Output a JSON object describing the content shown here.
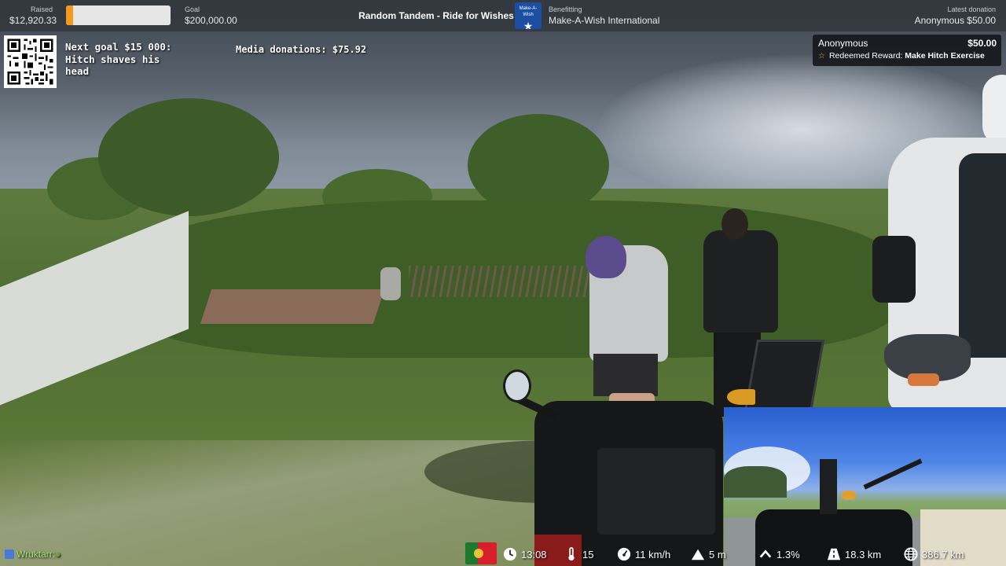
{
  "topbar": {
    "raised_label": "Raised",
    "raised_value": "$12,920.33",
    "progress_fraction": 0.065,
    "goal_label": "Goal",
    "goal_value": "$200,000.00",
    "stream_title": "Random Tandem - Ride for Wishes",
    "logo_text": "Make-A-Wish",
    "benefit_label": "Benefitting",
    "benefit_value": "Make-A-Wish International",
    "latest_label": "Latest donation",
    "latest_value": "Anonymous $50.00"
  },
  "overlay": {
    "next_goal_line1": "Next goal $15 000:",
    "next_goal_line2": "Hitch shaves his",
    "next_goal_line3": "head",
    "media_donations": "Media donations: $75.92"
  },
  "alert": {
    "name": "Anonymous",
    "amount": "$50.00",
    "redeemed_prefix": "Redeemed Reward: ",
    "reward": "Make Hitch Exercise"
  },
  "chat": {
    "user": "Wruktarr:"
  },
  "telemetry": {
    "time": "13:08",
    "temperature": "15",
    "speed": "11 km/h",
    "elevation": "5 m",
    "grade": "1.3%",
    "distance": "18.3 km",
    "total_distance": "386.7 km"
  },
  "colors": {
    "accent_orange": "#f39a1e",
    "bar_bg": "#34383e",
    "maw_blue": "#1c4fa3",
    "chat_green": "#9ee07a"
  },
  "icons": {
    "clock": "clock-icon",
    "thermometer": "thermometer-icon",
    "speed": "speedometer-icon",
    "elevation": "mountain-icon",
    "grade": "chevron-up-icon",
    "distance": "road-icon",
    "total": "globe-icon"
  }
}
